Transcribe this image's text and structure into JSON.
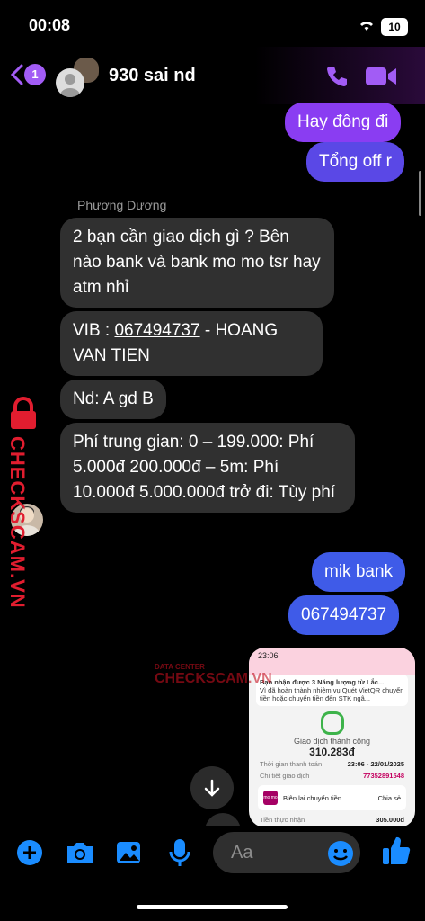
{
  "status_bar": {
    "time": "00:08",
    "battery": "10"
  },
  "header": {
    "back_count": "1",
    "contact_name": "930 sai nd"
  },
  "messages": {
    "out_1": "Hay đông đi",
    "out_2": "Tổng off r",
    "sender_name": "Phương Dương",
    "in_1": "2 bạn cần giao dịch gì ? Bên nào bank và bank mo mo tsr hay atm nhỉ",
    "in_2_prefix": "VIB : ",
    "in_2_link": "067494737",
    "in_2_suffix": " - HOANG VAN TIEN",
    "in_3": "Nd: A gd B",
    "in_4": "Phí trung gian:  0 – 199.000: Phí 5.000đ 200.000đ – 5m: Phí 10.000đ 5.000.000đ trở đi: Tùy phí",
    "out_3": "mik bank",
    "out_4": "067494737"
  },
  "image_preview": {
    "time": "23:06",
    "notif_title": "Bạn nhận được 3 Năng lượng từ Lắc...",
    "notif_body": "Vì đã hoàn thành nhiệm vụ  Quét VietQR chuyển tiền hoặc chuyển tiền đến STK ngâ...",
    "status": "Giao dịch thành công",
    "amount": "310.283đ",
    "time_label": "Thời gian thanh toán",
    "time_value": "23:06 - 22/01/2025",
    "detail_label": "Chi tiết giao dịch",
    "detail_value": "77352891548",
    "momo_logo": "mo mo",
    "receipt_label": "Biên lai chuyển tiền",
    "share_label": "Chia sẻ",
    "received_label": "Tiền thực nhận",
    "received_value": "305.000đ"
  },
  "composer": {
    "placeholder": "Aa"
  },
  "watermark": {
    "brand": "CHECKSCAM.VN",
    "tag": "DATA CENTER"
  },
  "colors": {
    "accent": "#a25cf5",
    "bubble_out": "#8a3df2",
    "bubble_out_blue": "#3f5be8",
    "bubble_in": "#303030",
    "icon_blue": "#1a8cff"
  }
}
